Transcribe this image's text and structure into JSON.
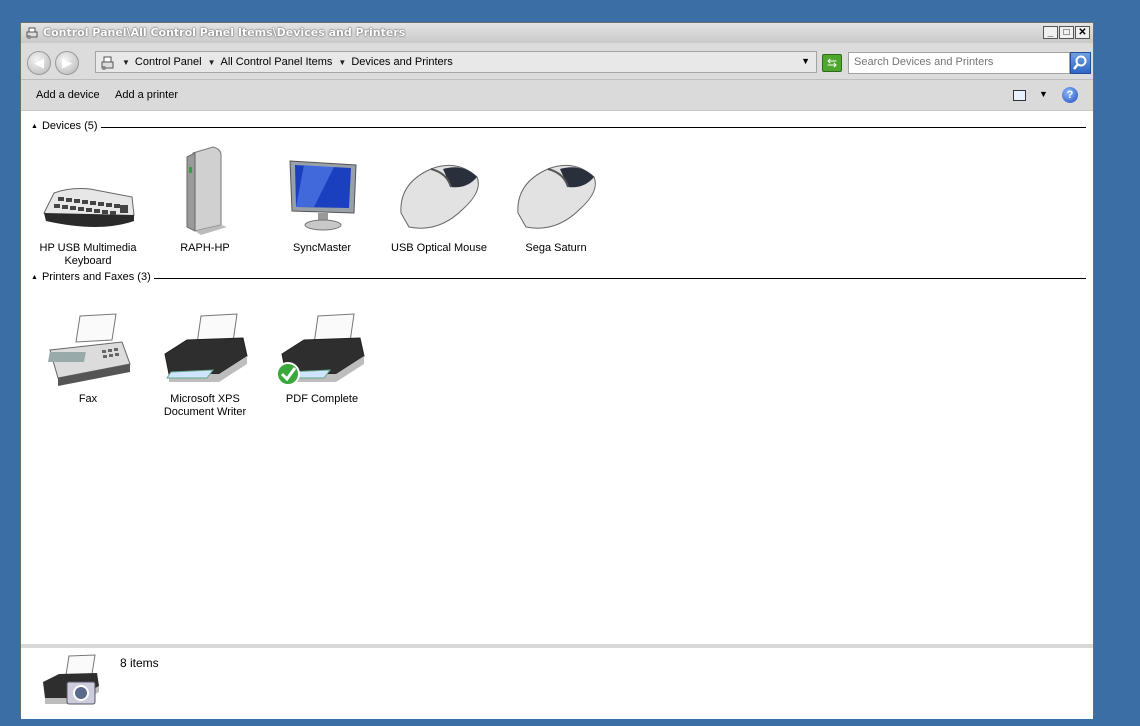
{
  "window": {
    "title": "Control Panel\\All Control Panel Items\\Devices and Printers"
  },
  "address": {
    "crumbs": [
      "Control Panel",
      "All Control Panel Items",
      "Devices and Printers"
    ]
  },
  "search": {
    "placeholder": "Search Devices and Printers"
  },
  "commands": {
    "add_device": "Add a device",
    "add_printer": "Add a printer"
  },
  "groups": [
    {
      "label": "Devices (5)",
      "items": [
        {
          "label": "HP USB Multimedia Keyboard",
          "icon": "keyboard-icon"
        },
        {
          "label": "RAPH-HP",
          "icon": "computer-tower-icon"
        },
        {
          "label": "SyncMaster",
          "icon": "monitor-icon"
        },
        {
          "label": "USB Optical Mouse",
          "icon": "mouse-icon"
        },
        {
          "label": "Sega Saturn",
          "icon": "mouse-icon"
        }
      ]
    },
    {
      "label": "Printers and Faxes (3)",
      "items": [
        {
          "label": "Fax",
          "icon": "fax-icon"
        },
        {
          "label": "Microsoft XPS Document Writer",
          "icon": "printer-icon"
        },
        {
          "label": "PDF Complete",
          "icon": "default-printer-icon",
          "default": true
        }
      ]
    }
  ],
  "status": {
    "text": "8 items",
    "icon": "printer-camera-icon"
  }
}
